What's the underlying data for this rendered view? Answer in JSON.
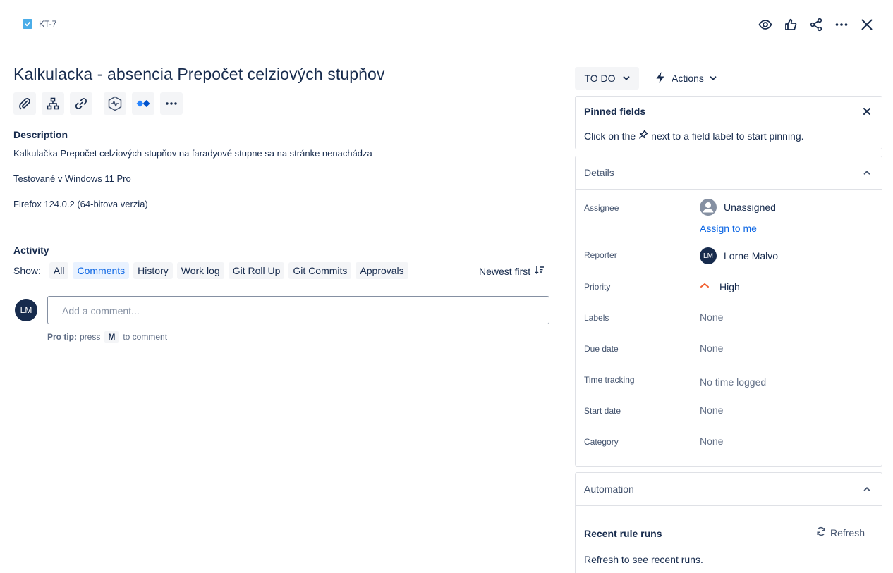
{
  "header": {
    "issue_key": "KT-7"
  },
  "issue": {
    "title": "Kalkulacka - absencia Prepočet celziových stupňov"
  },
  "description": {
    "heading": "Description",
    "lines": [
      "Kalkulačka Prepočet celziových stupňov na faradyové stupne sa na stránke nenachádza",
      "Testované v Windows 11 Pro",
      "Firefox 124.0.2 (64-bitova verzia)"
    ]
  },
  "activity": {
    "heading": "Activity",
    "show_label": "Show:",
    "filters": [
      "All",
      "Comments",
      "History",
      "Work log",
      "Git Roll Up",
      "Git Commits",
      "Approvals"
    ],
    "active_filter": "Comments",
    "sort_label": "Newest first",
    "avatar_initials": "LM",
    "comment_placeholder": "Add a comment...",
    "protip_bold": "Pro tip:",
    "protip_press": "press",
    "protip_key": "M",
    "protip_rest": "to comment"
  },
  "status": {
    "label": "TO DO",
    "actions_label": "Actions"
  },
  "pinned": {
    "title": "Pinned fields",
    "text_before": "Click on the",
    "text_after": "next to a field label to start pinning."
  },
  "details": {
    "title": "Details",
    "assignee_label": "Assignee",
    "assignee_value": "Unassigned",
    "assign_to_me": "Assign to me",
    "reporter_label": "Reporter",
    "reporter_initials": "LM",
    "reporter_value": "Lorne Malvo",
    "priority_label": "Priority",
    "priority_value": "High",
    "labels_label": "Labels",
    "labels_value": "None",
    "due_label": "Due date",
    "due_value": "None",
    "time_label": "Time tracking",
    "time_value": "No time logged",
    "start_label": "Start date",
    "start_value": "None",
    "category_label": "Category",
    "category_value": "None"
  },
  "automation": {
    "title": "Automation",
    "recent_label": "Recent rule runs",
    "refresh_label": "Refresh",
    "text": "Refresh to see recent runs."
  },
  "colors": {
    "accent": "#0c66e4",
    "avatar": "#172b4d",
    "priority_high": "#f15b2a",
    "task_icon": "#4bade8"
  }
}
